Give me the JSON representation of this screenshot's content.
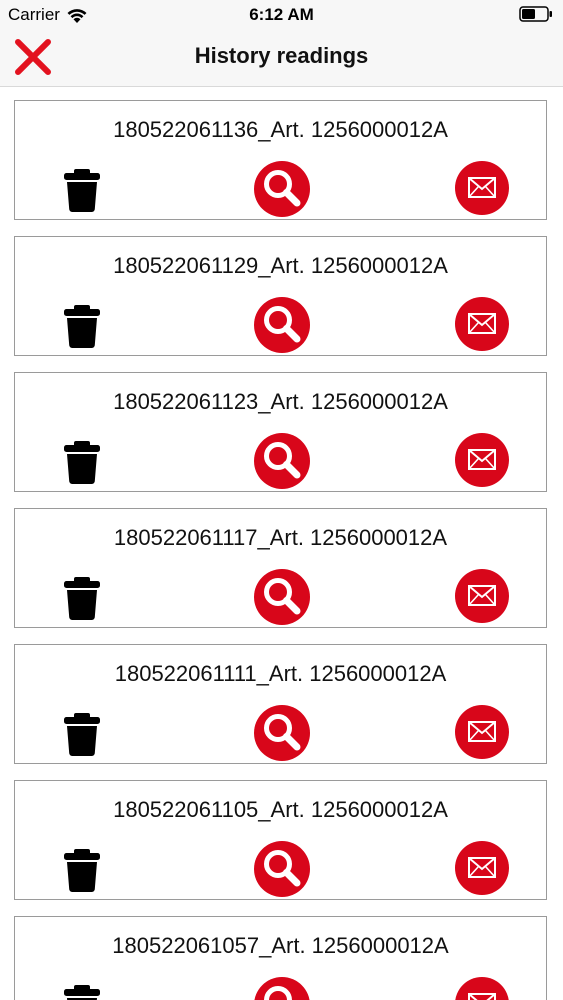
{
  "status_bar": {
    "carrier": "Carrier",
    "time": "6:12 AM"
  },
  "nav": {
    "title": "History readings",
    "close_icon": "close-x-icon"
  },
  "colors": {
    "accent": "#d8061a",
    "close": "#e3121f"
  },
  "readings": [
    {
      "label": "180522061136_Art. 1256000012A"
    },
    {
      "label": "180522061129_Art. 1256000012A"
    },
    {
      "label": "180522061123_Art. 1256000012A"
    },
    {
      "label": "180522061117_Art. 1256000012A"
    },
    {
      "label": "180522061111_Art. 1256000012A"
    },
    {
      "label": "180522061105_Art. 1256000012A"
    },
    {
      "label": "180522061057_Art. 1256000012A"
    }
  ]
}
